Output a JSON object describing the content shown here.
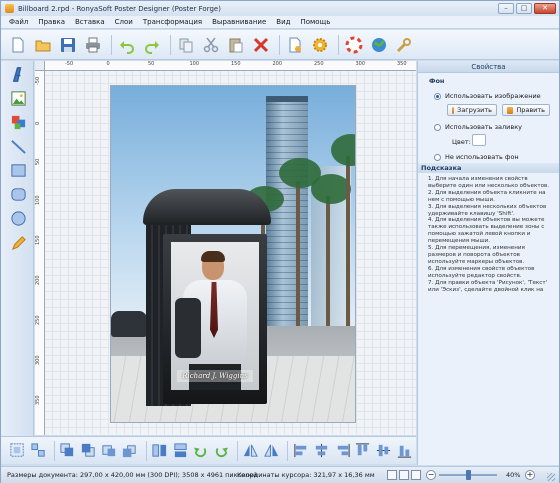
{
  "window": {
    "title": "Billboard 2.rpd - RonyaSoft Poster Designer (Poster Forge)",
    "buttons": [
      "–",
      "□",
      "✕"
    ]
  },
  "menu": [
    "Файл",
    "Правка",
    "Вставка",
    "Слои",
    "Трансформация",
    "Выравнивание",
    "Вид",
    "Помощь"
  ],
  "toolbar": {
    "icons": [
      "new-icon",
      "open-icon",
      "save-icon",
      "print-icon",
      "undo-icon",
      "redo-icon",
      "copy-icon",
      "cut-icon",
      "paste-icon",
      "delete-icon",
      "document-properties-icon",
      "settings-icon",
      "help-icon",
      "web-icon",
      "tools-icon"
    ]
  },
  "left_tools": [
    "text-tool-icon",
    "image-tool-icon",
    "clipart-tool-icon",
    "line-tool-icon",
    "rectangle-tool-icon",
    "rounded-rectangle-tool-icon",
    "ellipse-tool-icon",
    "pencil-tool-icon"
  ],
  "ruler": {
    "h_labels": [
      "-50",
      "0",
      "50",
      "100",
      "150",
      "200",
      "250",
      "300",
      "350"
    ],
    "v_labels": [
      "-50",
      "0",
      "50",
      "100",
      "150",
      "200",
      "250",
      "300",
      "350",
      "400"
    ]
  },
  "poster": {
    "name_text": "Richard J. Wiggins"
  },
  "properties": {
    "header": "Свойства",
    "section_background": "Фон",
    "radio_image": "Использовать изображение",
    "btn_load": "Загрузить",
    "btn_edit": "Править",
    "radio_fill": "Использовать заливку",
    "color_label": "Цвет:",
    "radio_none": "Не использовать фон",
    "hint_header": "Подсказка",
    "hint_text": "1. Для начала изменения свойств выберите один или несколько объектов.\n2. Для выделения объекта кликните на нем с помощью мыши.\n3. Для выделения нескольких объектов удерживайте клавишу 'Shift'.\n4. Для выделения объектов вы можете также использовать выделение зоны с помощью зажатой левой кнопки и перемещения мыши.\n5. Для перемещения, изменения размеров и поворота объектов используйте маркеры объектов.\n6. Для изменения свойств объектов используйте редактор свойств.\n7. Для правки объекта 'Рисунок', 'Текст' или 'Эскиз', сделайте двойной клик на"
  },
  "bottom_tools": [
    "group-icon",
    "ungroup-icon",
    "bring-front-icon",
    "send-back-icon",
    "bring-forward-icon",
    "send-backward-icon",
    "flip-horizontal-icon",
    "flip-vertical-icon",
    "rotate-left-icon",
    "rotate-right-icon",
    "mirror-left-icon",
    "mirror-right-icon",
    "align-left-icon",
    "align-center-icon",
    "align-right-icon",
    "align-top-icon",
    "align-middle-icon",
    "align-bottom-icon"
  ],
  "status": {
    "doc_size": "Размеры документа: 297,00 x 420,00 мм (300 DPI); 3508 x 4961 пикселей",
    "cursor": "Координаты курсора: 321,97 x 16,36 мм",
    "zoom": "40%",
    "zoom_level": 0.4
  }
}
